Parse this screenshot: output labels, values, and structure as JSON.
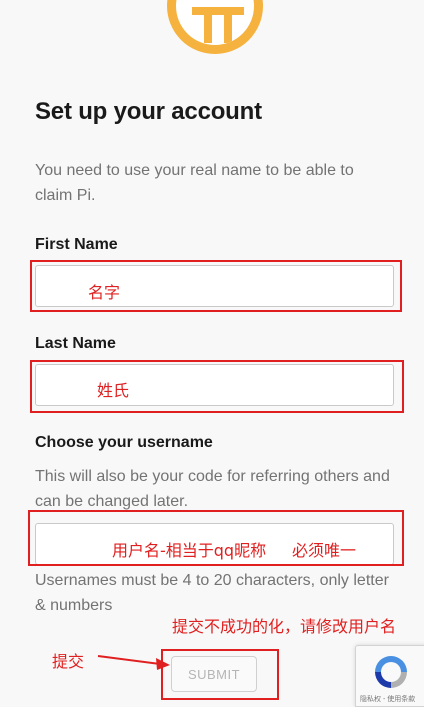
{
  "page": {
    "title": "Set up your account",
    "intro": "You need to use your real name to be able to claim Pi."
  },
  "form": {
    "first_name_label": "First Name",
    "last_name_label": "Last Name",
    "username_label": "Choose your username",
    "username_help": "This will also be your code for referring others and can be changed later.",
    "username_rules": "Usernames must be 4 to 20 characters, only letter & numbers",
    "submit_label": "SUBMIT"
  },
  "annotations": {
    "first_name_note": "名字",
    "last_name_note": "姓氏",
    "username_note": "用户名-相当于qq昵称",
    "username_note_2": "必须唯一",
    "submit_fail_note": "提交不成功的化，请修改用户名",
    "submit_note": "提交"
  },
  "recaptcha": {
    "links": "隐私权 - 使用条款"
  },
  "colors": {
    "brand": "#f5b23f",
    "annotation": "#e02020"
  },
  "icons": {
    "logo": "pi-logo-icon",
    "recaptcha": "recaptcha-icon"
  }
}
